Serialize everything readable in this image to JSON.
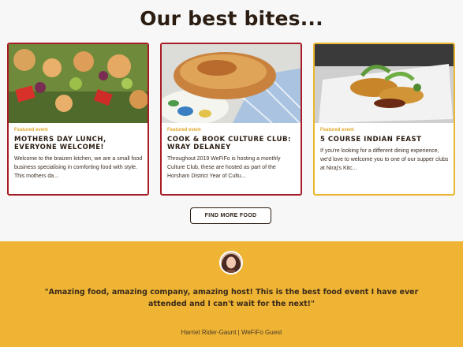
{
  "section": {
    "heading": "Our best bites..."
  },
  "cards": [
    {
      "tag": "Featured event",
      "title": "MOTHERS DAY LUNCH, EVERYONE WELCOME!",
      "description": "Welcome to the braizen kitchen, we are a small food business specialising in comforting food with style. This mothers da...",
      "border_color": "#a91c26"
    },
    {
      "tag": "Featured event",
      "title": "COOK & BOOK CULTURE CLUB: WRAY DELANEY",
      "description": "Throughout 2019 WeFiFo is hosting a monthly Culture Club, these are hosted as part of the Horsham District Year of Cultu...",
      "border_color": "#a91c26"
    },
    {
      "tag": "Featured event",
      "title": "5 COURSE INDIAN FEAST",
      "description": "If you're looking for a different dining experience, we'd love to welcome you to one of our supper clubs at Niraj's Kitc...",
      "border_color": "#eab530"
    }
  ],
  "find_more_button": {
    "label": "FIND MORE FOOD"
  },
  "testimonial": {
    "quote": "\"Amazing food, amazing company, amazing host! This is the best food event I have ever attended and I can't wait for the next!\"",
    "author": "Harriet Rider-Gaunt | WeFiFo Guest",
    "background_color": "#efb433"
  },
  "colors": {
    "accent_red": "#a91c26",
    "accent_gold": "#eab530",
    "text_dark": "#2b1d12"
  }
}
